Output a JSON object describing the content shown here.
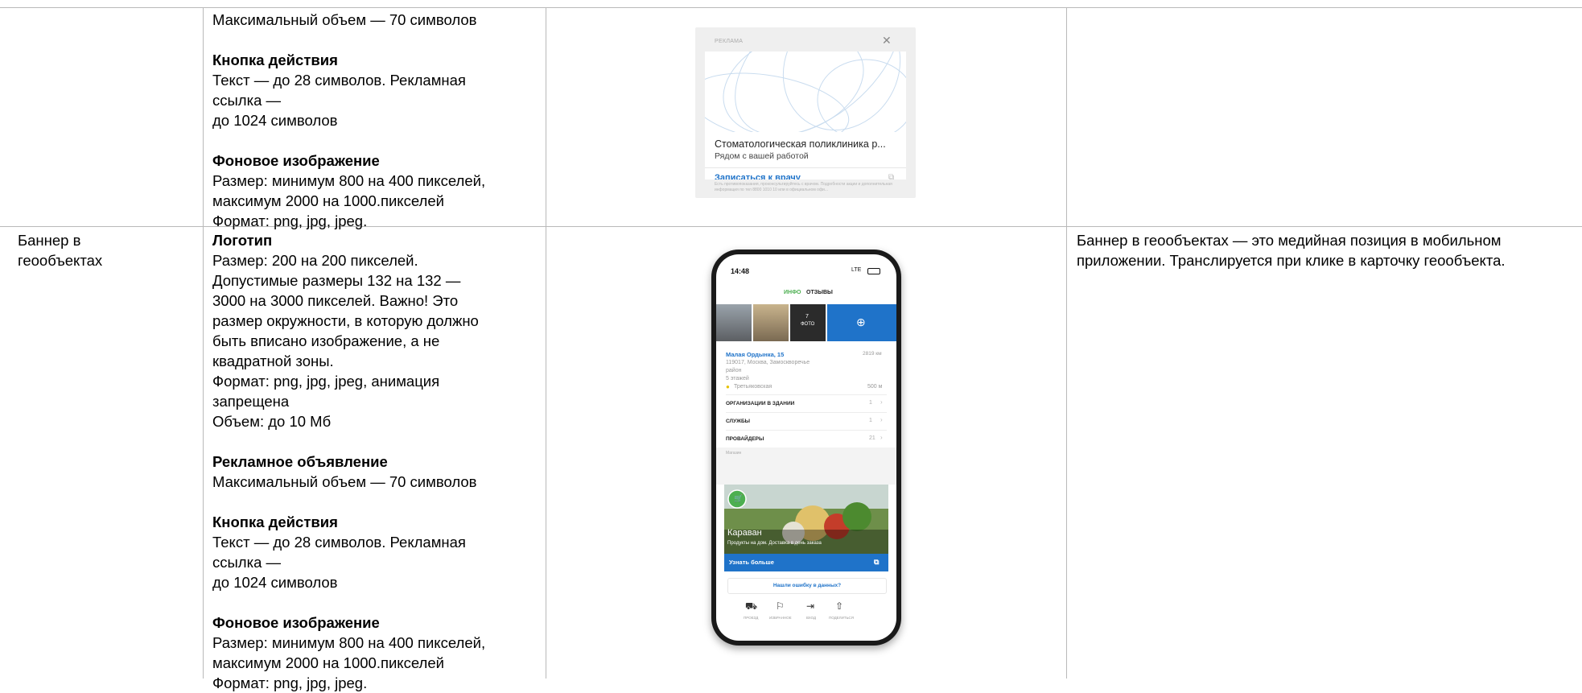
{
  "row1": {
    "specs": {
      "ad_text_volume": "Максимальный объем — 70 символов",
      "cta_heading": "Кнопка действия",
      "cta_lines": [
        "Текст — до 28 символов. Рекламная",
        "ссылка —",
        "до 1024 символов"
      ],
      "bg_heading": "Фоновое изображение",
      "bg_lines": [
        "Размер: минимум 800 на 400 пикселей,",
        "максимум 2000 на 1000.пикселей",
        "Формат: png, jpg, jpeg."
      ]
    },
    "ad_preview": {
      "tag": "РЕКЛАМА",
      "close": "✕",
      "title": "Стоматологическая поликлиника р...",
      "subtitle": "Рядом с вашей работой",
      "cta": "Записаться к врачу",
      "disclaimer": "Есть противопоказания, проконсультируйтесь с врачом. Подробности акции и дополнительная информация по тел 8800 1010 10 или в официальном офи..."
    }
  },
  "row2": {
    "name_lines": [
      "Баннер в",
      "геообъектах"
    ],
    "specs": {
      "logo_heading": "Логотип",
      "logo_lines": [
        "Размер: 200 на 200 пикселей.",
        "Допустимые размеры 132 на 132 —",
        "3000 на 3000 пикселей. Важно! Это",
        "размер окружности, в которую должно",
        "быть вписано изображение, а не",
        "квадратной зоны.",
        "Формат: png, jpg, jpeg, анимация",
        "запрещена",
        "Объем: до 10 Мб"
      ],
      "ad_heading": "Рекламное объявление",
      "ad_text_volume": "Максимальный объем — 70 символов",
      "cta_heading": "Кнопка действия",
      "cta_lines": [
        "Текст — до 28 символов. Рекламная",
        "ссылка —",
        "до 1024 символов"
      ],
      "bg_heading": "Фоновое изображение",
      "bg_lines": [
        "Размер: минимум 800 на 400 пикселей,",
        "максимум 2000 на 1000.пикселей",
        "Формат: png, jpg, jpeg."
      ]
    },
    "description_lines": [
      "Баннер в геообъектах — это медийная позиция в мобильном",
      "приложении. Транслируется при клике в карточку геообъекта."
    ],
    "phone": {
      "time": "14:48",
      "network": "LTE",
      "tab_info": "ИНФО",
      "tab_reviews": "ОТЗЫВЫ",
      "photo_count": "7",
      "photo_label": "ФОТО",
      "address": "Малая Ордынка, 15",
      "distance": "2819 км",
      "addr_lines": [
        "119017, Москва, Замоскворечье",
        "район",
        "5 этажей"
      ],
      "metro": "Третьяковская",
      "metro_distance": "500 м",
      "rows": [
        {
          "label": "ОРГАНИЗАЦИИ В ЗДАНИИ",
          "count": "1"
        },
        {
          "label": "СЛУЖБЫ",
          "count": "1"
        },
        {
          "label": "ПРОВАЙДЕРЫ",
          "count": "21"
        }
      ],
      "section_caption": "Магазин",
      "banner_title": "Караван",
      "banner_sub": "Продукты на дом. Доставка в день заказа",
      "banner_cta": "Узнать больше",
      "error_link": "Нашли ошибку в данных?",
      "nav": [
        "ПРОЕЗД",
        "ИЗБРАННОЕ",
        "ВХОД",
        "ПОДЕЛИТЬСЯ"
      ]
    }
  },
  "colors": {
    "border": "#b9b9b9",
    "link_blue": "#1f73c9",
    "green": "#4caf50"
  }
}
